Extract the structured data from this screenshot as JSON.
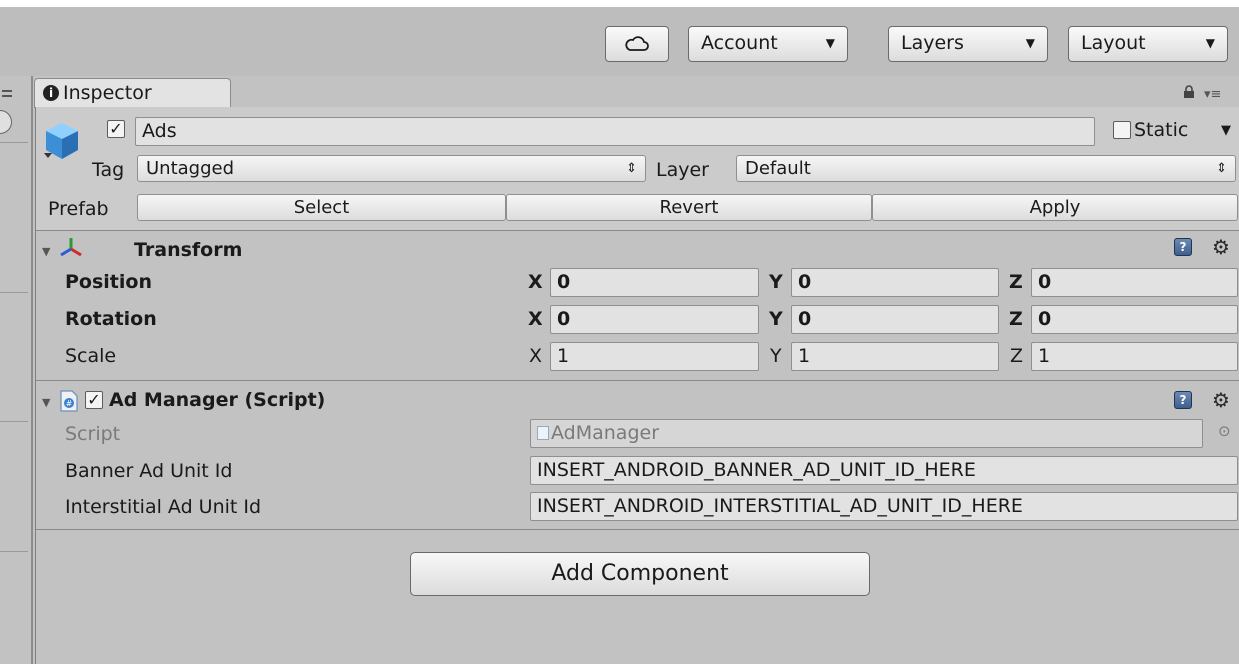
{
  "toolbar": {
    "account_label": "Account",
    "layers_label": "Layers",
    "layout_label": "Layout"
  },
  "tab": {
    "label": "Inspector"
  },
  "gameobject": {
    "active": true,
    "name": "Ads",
    "static_label": "Static",
    "static": false,
    "tag_label": "Tag",
    "tag_value": "Untagged",
    "layer_label": "Layer",
    "layer_value": "Default",
    "prefab_label": "Prefab",
    "prefab_buttons": [
      "Select",
      "Revert",
      "Apply"
    ]
  },
  "transform": {
    "title": "Transform",
    "rows": [
      {
        "label": "Position",
        "bold": true,
        "x": "0",
        "y": "0",
        "z": "0"
      },
      {
        "label": "Rotation",
        "bold": true,
        "x": "0",
        "y": "0",
        "z": "0"
      },
      {
        "label": "Scale",
        "bold": false,
        "x": "1",
        "y": "1",
        "z": "1"
      }
    ],
    "axis_labels": [
      "X",
      "Y",
      "Z"
    ]
  },
  "admanager": {
    "title": "Ad Manager (Script)",
    "enabled": true,
    "script_label": "Script",
    "script_value": "AdManager",
    "banner_label": "Banner Ad Unit Id",
    "banner_value": "INSERT_ANDROID_BANNER_AD_UNIT_ID_HERE",
    "interstitial_label": "Interstitial Ad Unit Id",
    "interstitial_value": "INSERT_ANDROID_INTERSTITIAL_AD_UNIT_ID_HERE"
  },
  "add_component_label": "Add Component",
  "icons": {
    "cloud": "cloud-icon",
    "info": "info-icon",
    "lock": "lock-icon",
    "menu": "context-menu-icon",
    "cube": "gameobject-cube-icon",
    "transform": "transform-axes-icon",
    "script": "csharp-script-icon",
    "help": "help-icon",
    "gear": "gear-icon"
  },
  "colors": {
    "background": "#c2c2c2",
    "field": "#e2e2e2",
    "cube_blue": "#3c8fd6"
  }
}
